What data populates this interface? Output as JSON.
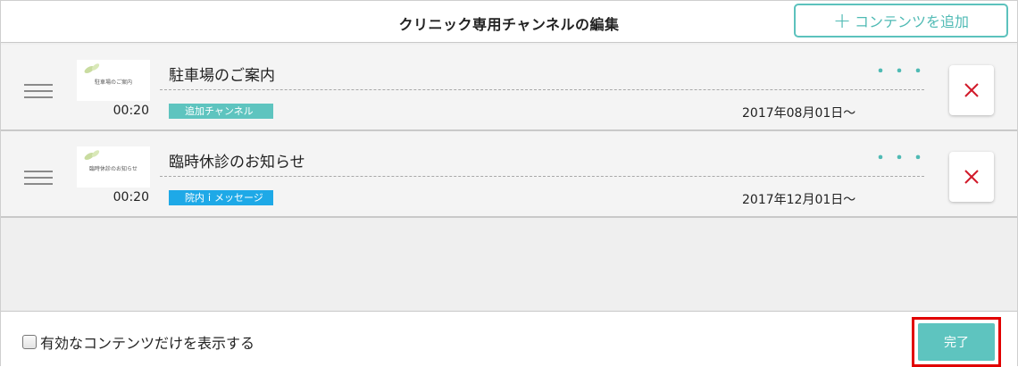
{
  "header": {
    "title": "クリニック専用チャンネルの編集",
    "add_button": {
      "icon": "plus-icon",
      "label": "コンテンツを追加"
    }
  },
  "items": [
    {
      "thumbnail_text": "駐車場のご案内",
      "duration": "00:20",
      "title": "駐車場のご案内",
      "more": "・・・",
      "tag": "追加チャンネル",
      "tag_color": "#5ec4bf",
      "date": "2017年08月01日〜"
    },
    {
      "thumbnail_text": "臨時休診のお知らせ",
      "duration": "00:20",
      "title": "臨時休診のお知らせ",
      "more": "・・・",
      "tag": "院内ｉメッセージ",
      "tag_color": "#1ea9e7",
      "date": "2017年12月01日〜"
    }
  ],
  "footer": {
    "filter_label": "有効なコンテンツだけを表示する",
    "filter_checked": false,
    "done_label": "完了"
  },
  "colors": {
    "accent": "#5ec4bf",
    "delete": "#d11a2a",
    "highlight": "#e10000"
  }
}
